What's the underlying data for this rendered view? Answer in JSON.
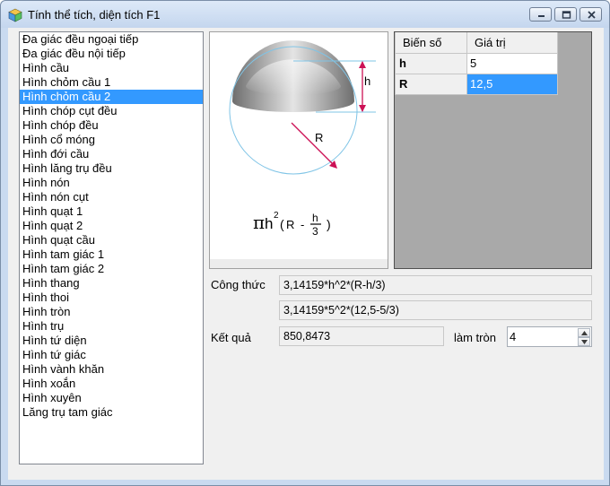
{
  "window": {
    "title": "Tính thể tích, diện tích F1"
  },
  "shapes": {
    "items": [
      "Đa giác đều ngoại tiếp",
      "Đa giác đều nội tiếp",
      "Hình cầu",
      "Hình chỏm cầu 1",
      "Hình chỏm cầu 2",
      "Hình chóp cụt đều",
      "Hình chóp đều",
      "Hình cổ móng",
      "Hình đới cầu",
      "Hình lăng trụ đều",
      "Hình nón",
      "Hình nón cụt",
      "Hình quạt 1",
      "Hình quạt 2",
      "Hình quạt cầu",
      "Hình tam giác 1",
      "Hình tam giác 2",
      "Hình thang",
      "Hình thoi",
      "Hình tròn",
      "Hình trụ",
      "Hình tứ diện",
      "Hình tứ giác",
      "Hình vành khăn",
      "Hình xoắn",
      "Hình xuyên",
      "Lăng trụ tam giác"
    ],
    "selected_index": 4
  },
  "figure": {
    "label_h": "h",
    "label_R": "R",
    "formula": {
      "pi": "π",
      "h": "h",
      "exp": "2",
      "open": "(",
      "R": "R",
      "minus": "-",
      "num": "h",
      "den": "3",
      "close": ")"
    },
    "colors": {
      "cap_dark": "#6e6e6e",
      "cap_light": "#e4e4e4",
      "circle": "#7fc4e6",
      "arrow": "#cc1155"
    }
  },
  "variables": {
    "headers": [
      "Biến số",
      "Giá trị"
    ],
    "rows": [
      {
        "name": "h",
        "value": "5"
      },
      {
        "name": "R",
        "value": "12,5"
      }
    ],
    "selected_row": 1
  },
  "results": {
    "formula_label": "Công thức",
    "formula_text": "3,14159*h^2*(R-h/3)",
    "substituted_text": "3,14159*5^2*(12,5-5/3)",
    "result_label": "Kết quả",
    "result_value": "850,8473",
    "round_label": "làm tròn",
    "round_value": "4"
  },
  "colors": {
    "selection": "#3399ff",
    "panel_bg": "#f0f0f0",
    "frame": "#c9daf0"
  }
}
